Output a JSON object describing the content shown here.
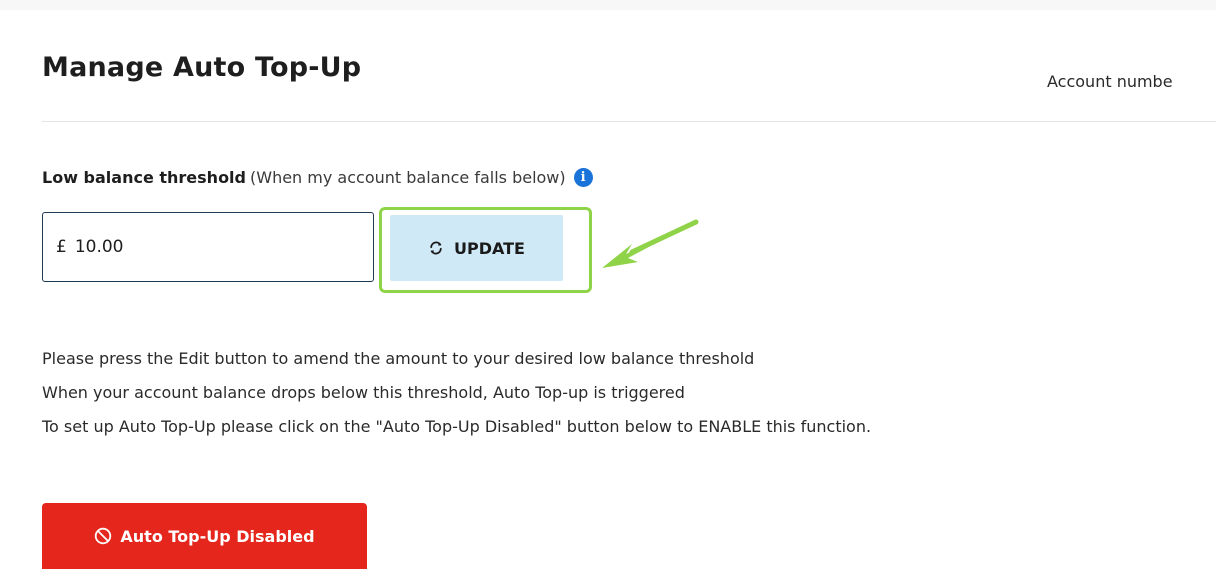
{
  "header": {
    "title": "Manage Auto Top-Up",
    "account_number_label": "Account numbe"
  },
  "threshold": {
    "label_bold": "Low balance threshold",
    "label_hint": "(When my account balance falls below)",
    "info_icon": "info-icon",
    "currency_symbol": "£",
    "amount_value": "10.00",
    "update_button_label": "UPDATE",
    "update_button_icon": "refresh-icon"
  },
  "annotation": {
    "highlight_color": "#8fd349"
  },
  "instructions": [
    "Please press the Edit button to amend the amount to your desired low balance threshold",
    "When your account balance drops below this threshold, Auto Top-up is triggered",
    "To set up Auto Top-Up please click on the \"Auto Top-Up Disabled\" button below to ENABLE this function."
  ],
  "auto_topup": {
    "button_label": "Auto Top-Up Disabled",
    "button_icon": "ban-icon",
    "button_color": "#e5261c"
  },
  "colors": {
    "update_button_bg": "#cfe9f7",
    "info_icon_bg": "#1a73d8",
    "input_border": "#1f3a54"
  }
}
